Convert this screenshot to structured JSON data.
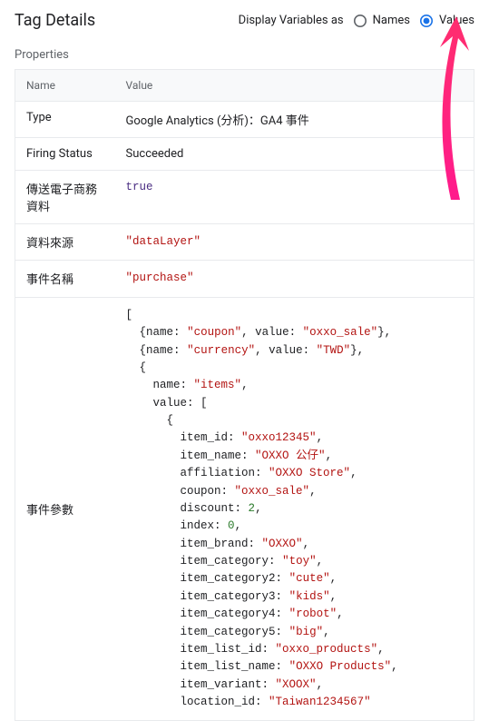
{
  "header": {
    "title": "Tag Details",
    "display_label": "Display Variables as",
    "option_names": "Names",
    "option_values": "Values"
  },
  "section_properties_label": "Properties",
  "table": {
    "head_name": "Name",
    "head_value": "Value",
    "rows": {
      "type": {
        "name": "Type",
        "value": "Google Analytics (分析)：GA4 事件"
      },
      "firing": {
        "name": "Firing Status",
        "value": "Succeeded"
      },
      "ecommerce": {
        "name": "傳送電子商務資料",
        "value": "true"
      },
      "data_source": {
        "name": "資料來源",
        "value": "\"dataLayer\""
      },
      "event_name": {
        "name": "事件名稱",
        "value": "\"purchase\""
      },
      "event_params": {
        "name": "事件參數"
      }
    }
  },
  "event_params_data": [
    {
      "name": "coupon",
      "value": "oxxo_sale"
    },
    {
      "name": "currency",
      "value": "TWD"
    },
    {
      "name": "items",
      "value": [
        {
          "item_id": "oxxo12345",
          "item_name": "OXXO 公仔",
          "affiliation": "OXXO Store",
          "coupon": "oxxo_sale",
          "discount": 2,
          "index": 0,
          "item_brand": "OXXO",
          "item_category": "toy",
          "item_category2": "cute",
          "item_category3": "kids",
          "item_category4": "robot",
          "item_category5": "big",
          "item_list_id": "oxxo_products",
          "item_list_name": "OXXO Products",
          "item_variant": "XOOX",
          "location_id": "Taiwan1234567"
        }
      ]
    }
  ],
  "colors": {
    "accent": "#1a73e8",
    "string": "#b31412"
  }
}
